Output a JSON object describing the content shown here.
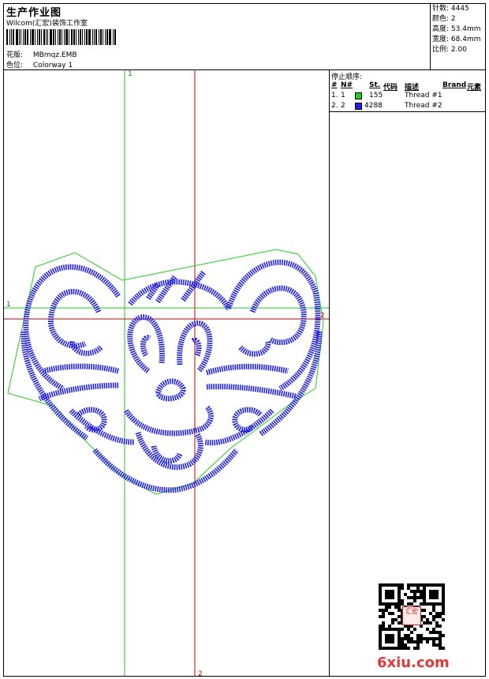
{
  "header": {
    "title": "生产作业图",
    "studio": "Wilcom(汇宏)装饰工作室",
    "design_label": "花版:",
    "design_value": "MBmqz.EMB",
    "colorway_label": "色位:",
    "colorway_value": "Colorway 1"
  },
  "stats": [
    {
      "label": "针数:",
      "value": "4445"
    },
    {
      "label": "颜色:",
      "value": "2"
    },
    {
      "label": "高度:",
      "value": "53.4mm"
    },
    {
      "label": "宽度:",
      "value": "68.4mm"
    },
    {
      "label": "比例:",
      "value": "2.00"
    }
  ],
  "stop_sequence": {
    "title": "停止顺序:",
    "columns": [
      "#",
      "N#",
      "St.",
      "代码",
      "描述",
      "Brand",
      "元素"
    ],
    "rows": [
      {
        "num": "1.",
        "n": "1",
        "color": "#22cc22",
        "code": "155",
        "desc": "Thread #1"
      },
      {
        "num": "2.",
        "n": "2",
        "color": "#1f1fdd",
        "code": "4288",
        "desc": "Thread #2"
      }
    ]
  },
  "canvas": {
    "marker_top": "1",
    "marker_left": "1",
    "marker_bottom": "2",
    "marker_right": "2",
    "outline_color": "#22cc22",
    "stitch_color": "#2020dd",
    "crosshair_color": "#cc0000"
  },
  "watermark": "6xiu.com",
  "stamp_text": "汇宏"
}
